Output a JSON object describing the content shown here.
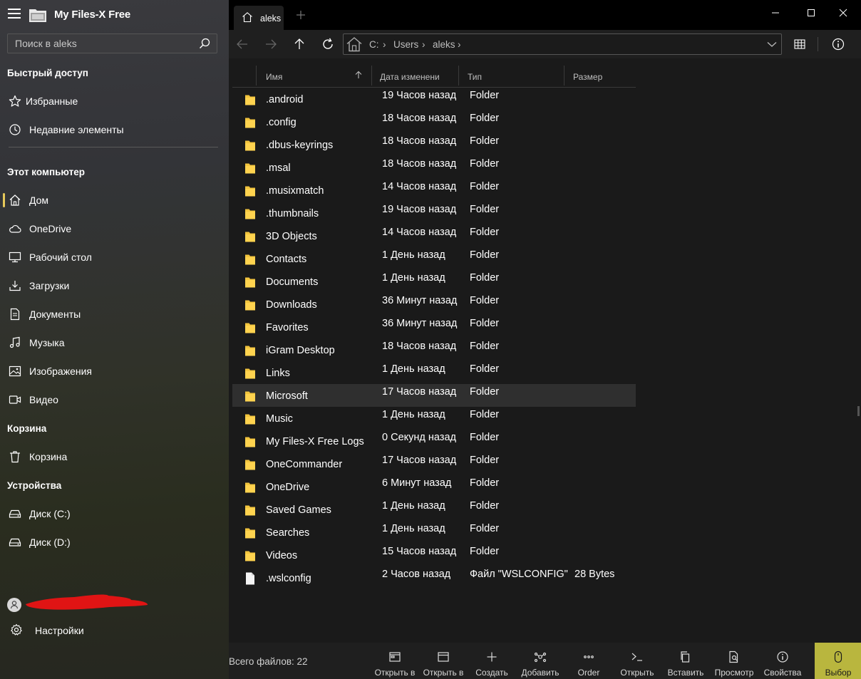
{
  "app": {
    "title": "My Files-X Free"
  },
  "search": {
    "placeholder": "Поиск в aleks"
  },
  "sidebar": {
    "quick_access_label": "Быстрый доступ",
    "quick_access": [
      {
        "label": "Избранные",
        "icon": "star-icon"
      },
      {
        "label": "Недавние элементы",
        "icon": "clock-icon"
      }
    ],
    "this_pc_label": "Этот компьютер",
    "this_pc": [
      {
        "label": "Дом",
        "icon": "home-icon",
        "active": true
      },
      {
        "label": "OneDrive",
        "icon": "cloud-icon"
      },
      {
        "label": "Рабочий стол",
        "icon": "desktop-icon"
      },
      {
        "label": "Загрузки",
        "icon": "download-icon"
      },
      {
        "label": "Документы",
        "icon": "document-icon"
      },
      {
        "label": "Музыка",
        "icon": "music-icon"
      },
      {
        "label": "Изображения",
        "icon": "image-icon"
      },
      {
        "label": "Видео",
        "icon": "video-icon"
      }
    ],
    "recycle_label": "Корзина",
    "recycle": [
      {
        "label": "Корзина",
        "icon": "trash-icon"
      }
    ],
    "devices_label": "Устройства",
    "devices": [
      {
        "label": "Диск (C:)",
        "icon": "drive-icon"
      },
      {
        "label": "Диск (D:)",
        "icon": "drive-icon"
      }
    ],
    "settings_label": "Настройки"
  },
  "tab": {
    "label": "aleks"
  },
  "breadcrumb": [
    "C:",
    "Users",
    "aleks"
  ],
  "columns": {
    "name": "Имя",
    "date": "Дата изменени",
    "type": "Тип",
    "size": "Размер"
  },
  "files": [
    {
      "name": ".android",
      "date": "19 Часов назад",
      "type": "Folder",
      "size": "",
      "kind": "folder"
    },
    {
      "name": ".config",
      "date": "18 Часов назад",
      "type": "Folder",
      "size": "",
      "kind": "folder"
    },
    {
      "name": ".dbus-keyrings",
      "date": "18 Часов назад",
      "type": "Folder",
      "size": "",
      "kind": "folder"
    },
    {
      "name": ".msal",
      "date": "18 Часов назад",
      "type": "Folder",
      "size": "",
      "kind": "folder"
    },
    {
      "name": ".musixmatch",
      "date": "14 Часов назад",
      "type": "Folder",
      "size": "",
      "kind": "folder"
    },
    {
      "name": ".thumbnails",
      "date": "19 Часов назад",
      "type": "Folder",
      "size": "",
      "kind": "folder"
    },
    {
      "name": "3D Objects",
      "date": "14 Часов назад",
      "type": "Folder",
      "size": "",
      "kind": "folder"
    },
    {
      "name": "Contacts",
      "date": "1 День назад",
      "type": "Folder",
      "size": "",
      "kind": "folder"
    },
    {
      "name": "Documents",
      "date": "1 День назад",
      "type": "Folder",
      "size": "",
      "kind": "folder"
    },
    {
      "name": "Downloads",
      "date": "36 Минут назад",
      "type": "Folder",
      "size": "",
      "kind": "folder"
    },
    {
      "name": "Favorites",
      "date": "36 Минут назад",
      "type": "Folder",
      "size": "",
      "kind": "folder"
    },
    {
      "name": "iGram Desktop",
      "date": "18 Часов назад",
      "type": "Folder",
      "size": "",
      "kind": "folder"
    },
    {
      "name": "Links",
      "date": "1 День назад",
      "type": "Folder",
      "size": "",
      "kind": "folder"
    },
    {
      "name": "Microsoft",
      "date": "17 Часов назад",
      "type": "Folder",
      "size": "",
      "kind": "folder",
      "selected": true
    },
    {
      "name": "Music",
      "date": "1 День назад",
      "type": "Folder",
      "size": "",
      "kind": "folder"
    },
    {
      "name": "My Files-X Free Logs",
      "date": "0 Секунд назад",
      "type": "Folder",
      "size": "",
      "kind": "folder"
    },
    {
      "name": "OneCommander",
      "date": "17 Часов назад",
      "type": "Folder",
      "size": "",
      "kind": "folder"
    },
    {
      "name": "OneDrive",
      "date": "6 Минут назад",
      "type": "Folder",
      "size": "",
      "kind": "folder"
    },
    {
      "name": "Saved Games",
      "date": "1 День назад",
      "type": "Folder",
      "size": "",
      "kind": "folder"
    },
    {
      "name": "Searches",
      "date": "1 День назад",
      "type": "Folder",
      "size": "",
      "kind": "folder"
    },
    {
      "name": "Videos",
      "date": "15 Часов назад",
      "type": "Folder",
      "size": "",
      "kind": "folder"
    },
    {
      "name": ".wslconfig",
      "date": "2 Часов назад",
      "type": "Файл \"WSLCONFIG\"",
      "size": "28 Bytes",
      "kind": "file"
    }
  ],
  "status": {
    "text": "Всего файлов: 22"
  },
  "commands": [
    {
      "label": "Открыть в",
      "icon": "open-window-icon"
    },
    {
      "label": "Открыть в",
      "icon": "open-tab-icon"
    },
    {
      "label": "Создать",
      "icon": "plus-icon"
    },
    {
      "label": "Добавить",
      "icon": "share-icon"
    },
    {
      "label": "Order",
      "icon": "more-icon"
    },
    {
      "label": "Открыть",
      "icon": "terminal-icon"
    },
    {
      "label": "Вставить",
      "icon": "paste-icon"
    },
    {
      "label": "Просмотр",
      "icon": "preview-icon"
    },
    {
      "label": "Свойства",
      "icon": "info-icon"
    },
    {
      "label": "Выбор",
      "icon": "mouse-icon",
      "accent": true
    }
  ],
  "colors": {
    "accent": "#b9b63e",
    "folder": "#f2c43d",
    "active_indicator": "#e6c95a"
  }
}
